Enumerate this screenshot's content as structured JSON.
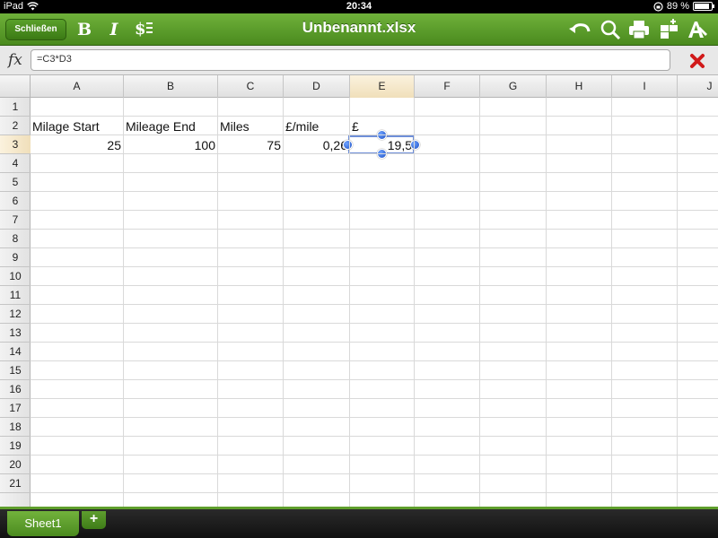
{
  "status": {
    "device": "iPad",
    "time": "20:34",
    "battery": "89 %",
    "battery_level": 0.89
  },
  "toolbar": {
    "close_label": "Schließen",
    "bold": "B",
    "italic": "I",
    "currency": "$",
    "title": "Unbenannt.xlsx"
  },
  "formula": {
    "label": "fx",
    "value": "=C3*D3"
  },
  "columns": [
    "A",
    "B",
    "C",
    "D",
    "E",
    "F",
    "G",
    "H",
    "I",
    "J"
  ],
  "rows": [
    "1",
    "2",
    "3",
    "4",
    "5",
    "6",
    "7",
    "8",
    "9",
    "10",
    "11",
    "12",
    "13",
    "14",
    "15",
    "16",
    "17",
    "18",
    "19",
    "20",
    "21"
  ],
  "cells": {
    "A2": "Milage Start",
    "B2": "Mileage End",
    "C2": "Miles",
    "D2": "£/mile",
    "E2": "£",
    "A3": "25",
    "B3": "100",
    "C3": "75",
    "D3": "0,26",
    "E3": "19,5"
  },
  "sheets": {
    "active": "Sheet1",
    "add": "+"
  },
  "colors": {
    "toolbar_green": "#4a8a1e",
    "selection_blue": "#6f8fd8",
    "cancel_red": "#d11a1a"
  }
}
